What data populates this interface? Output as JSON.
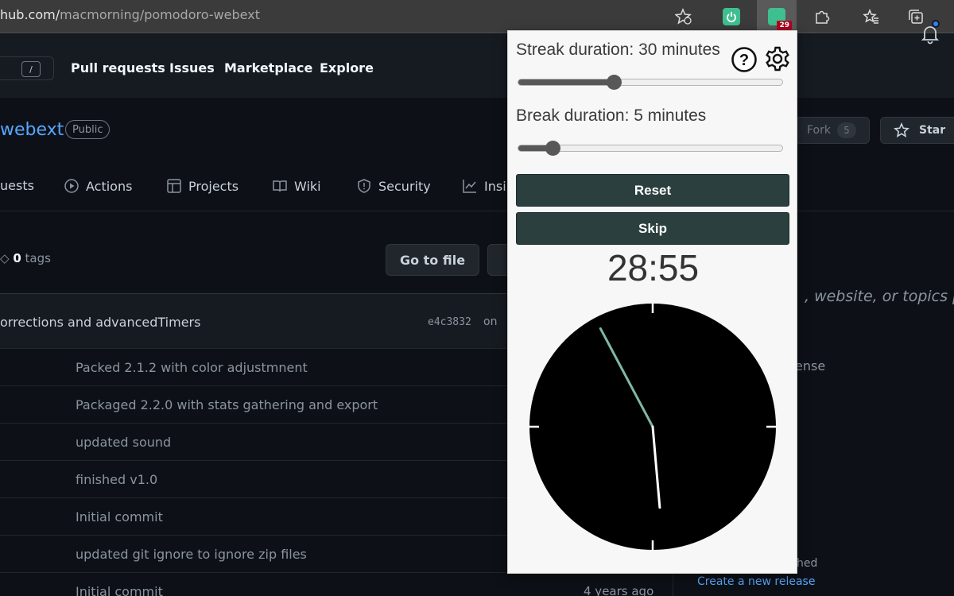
{
  "browser": {
    "url_host": "hub.com/",
    "url_path": "macmorning/pomodoro-webext",
    "extension_badge": "29",
    "icons": [
      "star-add-icon",
      "power-extension-icon",
      "pomodoro-extension-icon",
      "puzzle-icon",
      "favorites-icon",
      "collections-icon"
    ]
  },
  "github_header": {
    "search_shortcut": "/",
    "nav": [
      "Pull requests",
      "Issues",
      "Marketplace",
      "Explore"
    ]
  },
  "repo": {
    "name": "webext",
    "visibility": "Public",
    "fork_label": "Fork",
    "fork_count": "5",
    "star_label": "Star",
    "tabs": [
      "uests",
      "Actions",
      "Projects",
      "Wiki",
      "Security",
      "Insi"
    ],
    "tags_count": "0",
    "tags_label": "tags",
    "goto_file": "Go to file",
    "latest_commit": {
      "message": "orrections and advancedTimers",
      "hash": "e4c3832",
      "on": "on"
    },
    "files": [
      {
        "message": "Packed 2.1.2 with color adjustmnent",
        "age": ""
      },
      {
        "message": "Packaged 2.2.0 with stats gathering and export",
        "age": ""
      },
      {
        "message": "updated sound",
        "age": ""
      },
      {
        "message": "finished v1.0",
        "age": ""
      },
      {
        "message": "Initial commit",
        "age": ""
      },
      {
        "message": "updated git ignore to ignore zip files",
        "age": ""
      },
      {
        "message": "Initial commit",
        "age": "4 years ago"
      }
    ],
    "about_placeholder": ", website, or topics pro",
    "license_fragment": "ense",
    "releases_fragment": "hed",
    "create_release": "Create a new release"
  },
  "popup": {
    "streak_label": "Streak duration: 30 minutes",
    "streak_minutes": 30,
    "streak_fraction": 0.36,
    "break_label": "Break duration: 5 minutes",
    "break_minutes": 5,
    "break_fraction": 0.13,
    "reset_label": "Reset",
    "skip_label": "Skip",
    "timer": "28:55",
    "clock": {
      "face_color": "#000000",
      "minute_hand_color": "#7fb8a4",
      "second_hand_color": "#ffffff",
      "minute_hand_angle_deg": -28,
      "second_hand_angle_deg": 175
    },
    "icons": [
      "help-icon",
      "settings-icon"
    ]
  }
}
